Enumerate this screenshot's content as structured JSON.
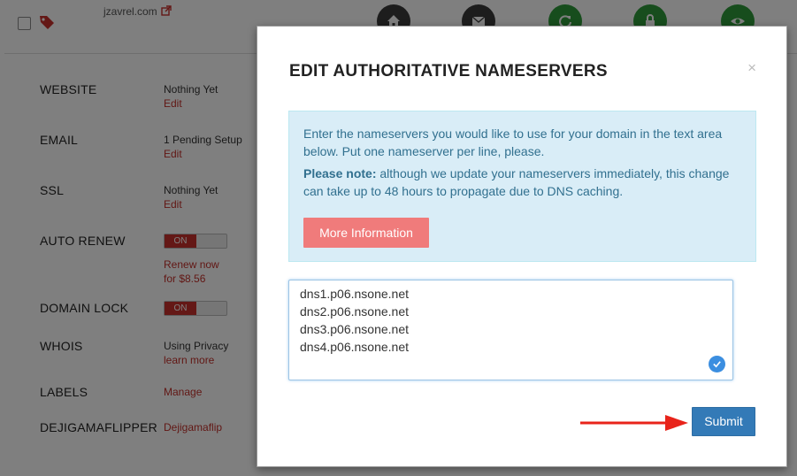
{
  "header": {
    "domain": "jzavrel.com",
    "icons": [
      "home-icon",
      "mail-icon",
      "refresh-icon",
      "lock-icon",
      "eye-icon"
    ]
  },
  "rows": {
    "website": {
      "label": "WEBSITE",
      "value": "Nothing Yet",
      "link": "Edit"
    },
    "email": {
      "label": "EMAIL",
      "value": "1 Pending Setup",
      "link": "Edit"
    },
    "ssl": {
      "label": "SSL",
      "value": "Nothing Yet",
      "link": "Edit"
    },
    "auto_renew": {
      "label": "AUTO RENEW",
      "toggle": "ON",
      "link_line1": "Renew now",
      "link_line2": "for $8.56"
    },
    "domain_lock": {
      "label": "DOMAIN LOCK",
      "toggle": "ON"
    },
    "whois": {
      "label": "WHOIS",
      "value": "Using Privacy",
      "link": "learn more"
    },
    "labels": {
      "label": "LABELS",
      "link": "Manage"
    },
    "custom": {
      "label": "DEJIGAMAFLIPPER",
      "link": "Dejigamaflip"
    }
  },
  "modal": {
    "title": "EDIT AUTHORITATIVE NAMESERVERS",
    "close": "×",
    "info_text": "Enter the nameservers you would like to use for your domain in the text area below. Put one nameserver per line, please.",
    "note_label": "Please note:",
    "note_text": " although we update your nameservers immediately, this change can take up to 48 hours to propagate due to DNS caching.",
    "more_info_label": "More Information",
    "nameservers": [
      "dns1.p06.nsone.net",
      "dns2.p06.nsone.net",
      "dns3.p06.nsone.net",
      "dns4.p06.nsone.net"
    ],
    "submit_label": "Submit"
  },
  "colors": {
    "accent_blue": "#337ab7",
    "info_bg": "#d9edf7",
    "more_info_btn": "#f07b7b",
    "toggle_on": "#c9302c",
    "arrow": "#e8231a"
  }
}
